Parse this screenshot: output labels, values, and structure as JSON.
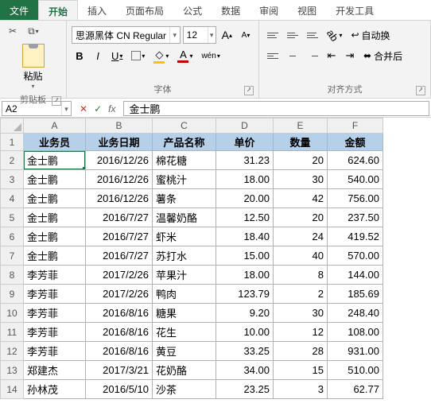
{
  "tabs": {
    "file": "文件",
    "home": "开始",
    "insert": "插入",
    "layout": "页面布局",
    "formula": "公式",
    "data": "数据",
    "review": "审阅",
    "view": "视图",
    "dev": "开发工具"
  },
  "clipboard": {
    "paste": "粘贴",
    "label": "剪贴板"
  },
  "font": {
    "name": "思源黑体 CN Regular",
    "size": "12",
    "incA": "A",
    "decA": "A",
    "bold": "B",
    "italic": "I",
    "under": "U",
    "label": "字体",
    "wen": "wén",
    "fontcolor": "A",
    "fill": "◊"
  },
  "align": {
    "label": "对齐方式",
    "wrap": "自动换",
    "merge": "合并后"
  },
  "namebox": "A2",
  "formula_value": "金士鹏",
  "cols": [
    "A",
    "B",
    "C",
    "D",
    "E",
    "F"
  ],
  "headers": [
    "业务员",
    "业务日期",
    "产品名称",
    "单价",
    "数量",
    "金额"
  ],
  "rows": [
    [
      "金士鹏",
      "2016/12/26",
      "棉花糖",
      "31.23",
      "20",
      "624.60"
    ],
    [
      "金士鹏",
      "2016/12/26",
      "蜜桃汁",
      "18.00",
      "30",
      "540.00"
    ],
    [
      "金士鹏",
      "2016/12/26",
      "薯条",
      "20.00",
      "42",
      "756.00"
    ],
    [
      "金士鹏",
      "2016/7/27",
      "温馨奶酪",
      "12.50",
      "20",
      "237.50"
    ],
    [
      "金士鹏",
      "2016/7/27",
      "虾米",
      "18.40",
      "24",
      "419.52"
    ],
    [
      "金士鹏",
      "2016/7/27",
      "苏打水",
      "15.00",
      "40",
      "570.00"
    ],
    [
      "李芳菲",
      "2017/2/26",
      "苹果汁",
      "18.00",
      "8",
      "144.00"
    ],
    [
      "李芳菲",
      "2017/2/26",
      "鸭肉",
      "123.79",
      "2",
      "185.69"
    ],
    [
      "李芳菲",
      "2016/8/16",
      "糖果",
      "9.20",
      "30",
      "248.40"
    ],
    [
      "李芳菲",
      "2016/8/16",
      "花生",
      "10.00",
      "12",
      "108.00"
    ],
    [
      "李芳菲",
      "2016/8/16",
      "黄豆",
      "33.25",
      "28",
      "931.00"
    ],
    [
      "郑建杰",
      "2017/3/21",
      "花奶酪",
      "34.00",
      "15",
      "510.00"
    ],
    [
      "孙林茂",
      "2016/5/10",
      "沙茶",
      "23.25",
      "3",
      "62.77"
    ]
  ],
  "chart_data": {
    "type": "table",
    "columns": [
      "业务员",
      "业务日期",
      "产品名称",
      "单价",
      "数量",
      "金额"
    ],
    "records": [
      {
        "业务员": "金士鹏",
        "业务日期": "2016/12/26",
        "产品名称": "棉花糖",
        "单价": 31.23,
        "数量": 20,
        "金额": 624.6
      },
      {
        "业务员": "金士鹏",
        "业务日期": "2016/12/26",
        "产品名称": "蜜桃汁",
        "单价": 18.0,
        "数量": 30,
        "金额": 540.0
      },
      {
        "业务员": "金士鹏",
        "业务日期": "2016/12/26",
        "产品名称": "薯条",
        "单价": 20.0,
        "数量": 42,
        "金额": 756.0
      },
      {
        "业务员": "金士鹏",
        "业务日期": "2016/7/27",
        "产品名称": "温馨奶酪",
        "单价": 12.5,
        "数量": 20,
        "金额": 237.5
      },
      {
        "业务员": "金士鹏",
        "业务日期": "2016/7/27",
        "产品名称": "虾米",
        "单价": 18.4,
        "数量": 24,
        "金额": 419.52
      },
      {
        "业务员": "金士鹏",
        "业务日期": "2016/7/27",
        "产品名称": "苏打水",
        "单价": 15.0,
        "数量": 40,
        "金额": 570.0
      },
      {
        "业务员": "李芳菲",
        "业务日期": "2017/2/26",
        "产品名称": "苹果汁",
        "单价": 18.0,
        "数量": 8,
        "金额": 144.0
      },
      {
        "业务员": "李芳菲",
        "业务日期": "2017/2/26",
        "产品名称": "鸭肉",
        "单价": 123.79,
        "数量": 2,
        "金额": 185.69
      },
      {
        "业务员": "李芳菲",
        "业务日期": "2016/8/16",
        "产品名称": "糖果",
        "单价": 9.2,
        "数量": 30,
        "金额": 248.4
      },
      {
        "业务员": "李芳菲",
        "业务日期": "2016/8/16",
        "产品名称": "花生",
        "单价": 10.0,
        "数量": 12,
        "金额": 108.0
      },
      {
        "业务员": "李芳菲",
        "业务日期": "2016/8/16",
        "产品名称": "黄豆",
        "单价": 33.25,
        "数量": 28,
        "金额": 931.0
      },
      {
        "业务员": "郑建杰",
        "业务日期": "2017/3/21",
        "产品名称": "花奶酪",
        "单价": 34.0,
        "数量": 15,
        "金额": 510.0
      },
      {
        "业务员": "孙林茂",
        "业务日期": "2016/5/10",
        "产品名称": "沙茶",
        "单价": 23.25,
        "数量": 3,
        "金额": 62.77
      }
    ]
  }
}
